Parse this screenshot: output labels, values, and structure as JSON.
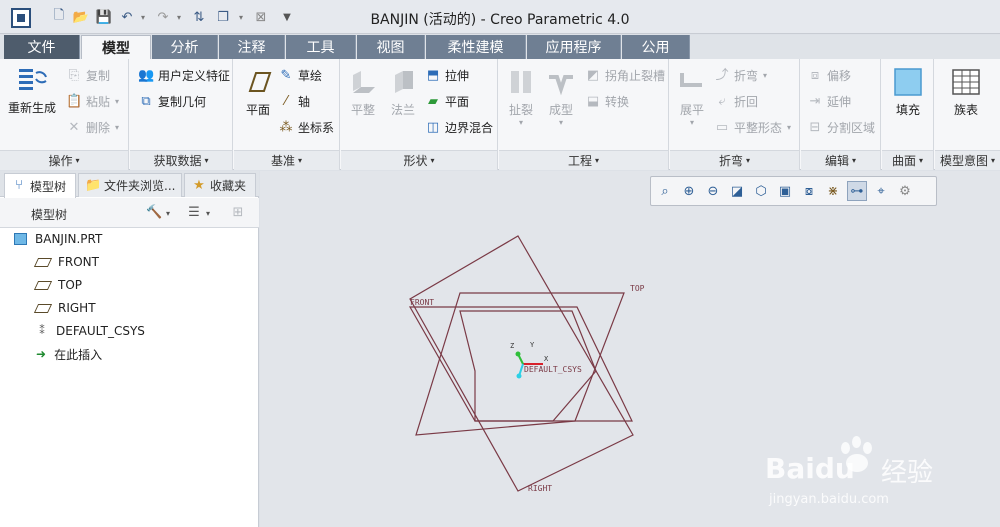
{
  "window": {
    "title": "BANJIN (活动的) - Creo Parametric 4.0"
  },
  "quick_access": [
    "new-icon",
    "open-icon",
    "save-icon",
    "undo-icon",
    "redo-icon",
    "regenerate-icon",
    "windows-icon",
    "close-icon",
    "customize-icon"
  ],
  "tabs": [
    {
      "label": "文件"
    },
    {
      "label": "模型"
    },
    {
      "label": "分析"
    },
    {
      "label": "注释"
    },
    {
      "label": "工具"
    },
    {
      "label": "视图"
    },
    {
      "label": "柔性建模"
    },
    {
      "label": "应用程序"
    },
    {
      "label": "公用"
    }
  ],
  "ribbon": {
    "operations": {
      "label": "操作",
      "regenerate": "重新生成",
      "copy": "复制",
      "paste": "粘贴",
      "delete": "删除"
    },
    "get_data": {
      "label": "获取数据",
      "udf": "用户定义特征",
      "copy_geom": "复制几何"
    },
    "datum": {
      "label": "基准",
      "plane": "平面",
      "sketch": "草绘",
      "axis": "轴",
      "csys": "坐标系"
    },
    "shapes": {
      "label": "形状",
      "flat": "平整",
      "flange": "法兰",
      "extrude": "拉伸",
      "plane": "平面",
      "blend": "边界混合"
    },
    "engineering": {
      "label": "工程",
      "rip": "扯裂",
      "form": "成型",
      "corner_relief": "拐角止裂槽",
      "convert": "转换"
    },
    "bends": {
      "label": "折弯",
      "unbend": "展平",
      "bend": "折弯",
      "bend_back": "折回",
      "flat_state": "平整形态"
    },
    "editing": {
      "label": "编辑",
      "offset": "偏移",
      "extend": "延伸",
      "split": "分割区域"
    },
    "surfaces": {
      "label": "曲面",
      "fill": "填充"
    },
    "model_intent": {
      "label": "模型意图",
      "family_table": "族表"
    }
  },
  "sidebar": {
    "tabs": [
      {
        "label": "模型树"
      },
      {
        "label": "文件夹浏览..."
      },
      {
        "label": "收藏夹"
      }
    ],
    "header": "模型树",
    "items": [
      {
        "label": "BANJIN.PRT",
        "icon": "part-icon"
      },
      {
        "label": "FRONT",
        "icon": "datum-plane-icon"
      },
      {
        "label": "TOP",
        "icon": "datum-plane-icon"
      },
      {
        "label": "RIGHT",
        "icon": "datum-plane-icon"
      },
      {
        "label": "DEFAULT_CSYS",
        "icon": "csys-icon"
      },
      {
        "label": "在此插入",
        "icon": "insert-here-icon"
      }
    ]
  },
  "viewport": {
    "plane_labels": {
      "front": "FRONT",
      "top": "TOP",
      "right": "RIGHT"
    },
    "csys_label": "DEFAULT_CSYS",
    "axis_labels": {
      "x": "X",
      "y": "Y",
      "z": "Z"
    },
    "datum_color": "#7a3a46",
    "toolbar": [
      "refit-icon",
      "zoom-in-icon",
      "zoom-out-icon",
      "repaint-icon",
      "display-style-icon",
      "saved-views-icon",
      "view-manager-icon",
      "plane-display-icon",
      "csys-display-icon",
      "spin-center-icon",
      "annotation-display-icon"
    ]
  },
  "watermark": {
    "brand": "Baidu",
    "cn": "经验",
    "url": "jingyan.baidu.com"
  }
}
